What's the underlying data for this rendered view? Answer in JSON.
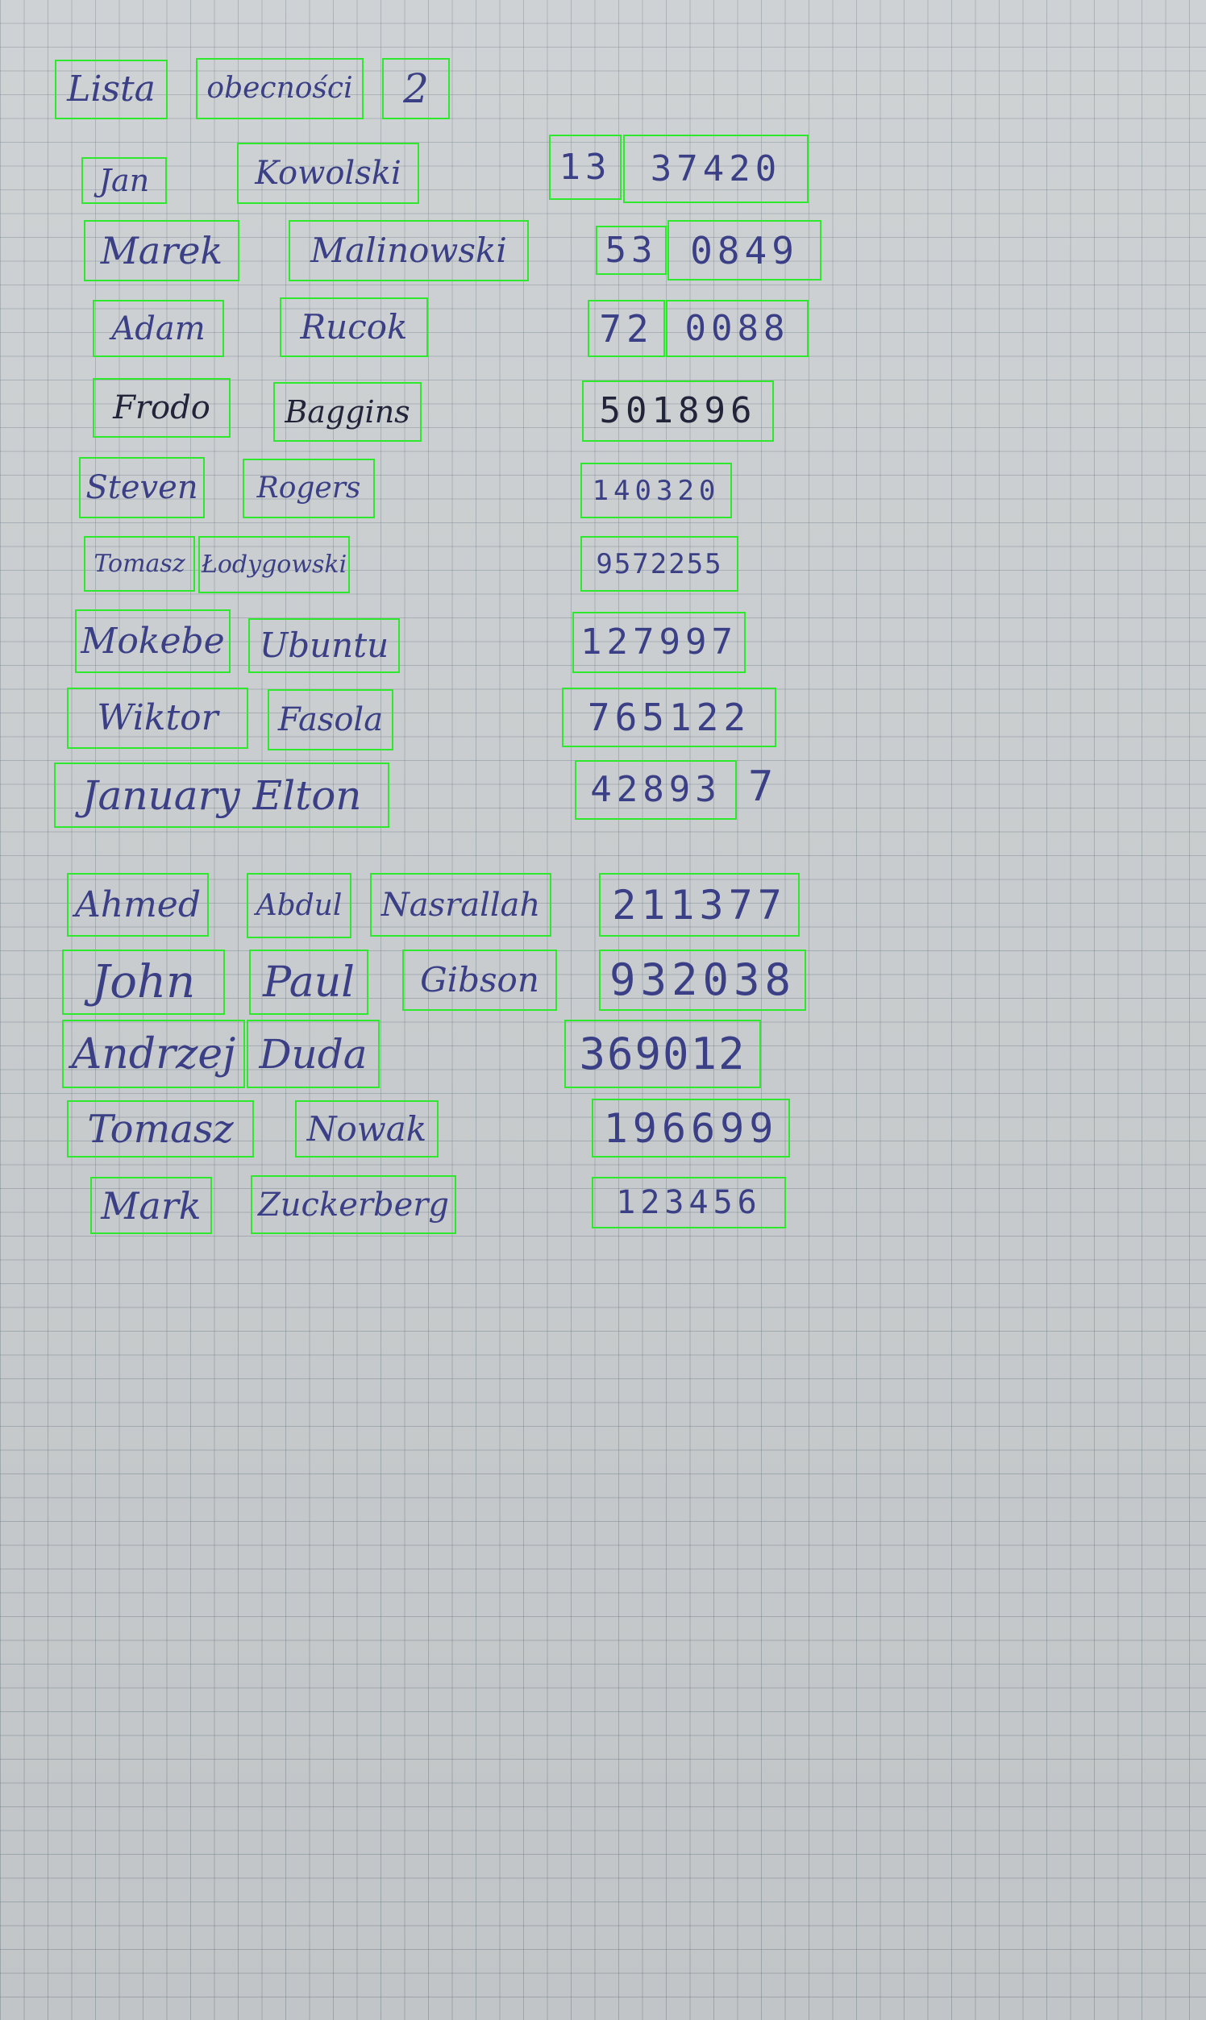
{
  "title": [
    "Lista",
    "obecności",
    "2"
  ],
  "rows": [
    {
      "words": [
        "Jan",
        "Kowolski"
      ],
      "numbers": [
        "13",
        "37420"
      ]
    },
    {
      "words": [
        "Marek",
        "Malinowski"
      ],
      "numbers": [
        "53",
        "0849"
      ]
    },
    {
      "words": [
        "Adam",
        "Rucok"
      ],
      "numbers": [
        "72",
        "0088"
      ]
    },
    {
      "words": [
        "Frodo",
        "Baggins"
      ],
      "numbers": [
        "501896"
      ]
    },
    {
      "words": [
        "Steven",
        "Rogers"
      ],
      "numbers": [
        "140320"
      ]
    },
    {
      "words": [
        "Tomasz",
        "Łodygowski"
      ],
      "numbers": [
        "9572255"
      ]
    },
    {
      "words": [
        "Mokebe",
        "Ubuntu"
      ],
      "numbers": [
        "127997"
      ]
    },
    {
      "words": [
        "Wiktor",
        "Fasola"
      ],
      "numbers": [
        "765122"
      ]
    },
    {
      "words": [
        "January Elton"
      ],
      "numbers": [
        "42893"
      ],
      "extra": "7"
    },
    {
      "words": [
        "Ahmed",
        "Abdul",
        "Nasrallah"
      ],
      "numbers": [
        "211377"
      ]
    },
    {
      "words": [
        "John",
        "Paul",
        "Gibson"
      ],
      "numbers": [
        "932038"
      ]
    },
    {
      "words": [
        "Andrzej",
        "Duda"
      ],
      "numbers": [
        "369012"
      ]
    },
    {
      "words": [
        "Tomasz",
        "Nowak"
      ],
      "numbers": [
        "196699"
      ]
    },
    {
      "words": [
        "Mark",
        "Zuckerberg"
      ],
      "numbers": [
        "123456"
      ]
    }
  ]
}
